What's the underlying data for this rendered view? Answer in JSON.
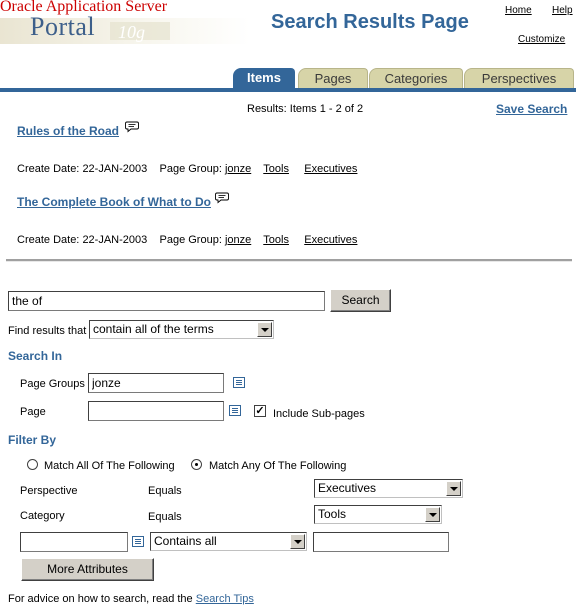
{
  "header": {
    "brand_top": "Oracle Application Server",
    "brand_product": "Portal",
    "brand_version": "10g",
    "page_title": "Search Results Page",
    "links": {
      "home": "Home",
      "help": "Help",
      "customize": "Customize"
    }
  },
  "tabs": [
    {
      "label": "Items",
      "active": true
    },
    {
      "label": "Pages",
      "active": false
    },
    {
      "label": "Categories",
      "active": false
    },
    {
      "label": "Perspectives",
      "active": false
    }
  ],
  "results": {
    "summary": "Results: Items 1 - 2 of 2",
    "save_search": "Save Search",
    "items": [
      {
        "title": "Rules of the Road",
        "create_label": "Create Date:",
        "create_date": "22-JAN-2003",
        "page_group_label": "Page Group:",
        "page_group": "jonze",
        "category": "Tools",
        "perspective": "Executives"
      },
      {
        "title": "The Complete Book of What to Do",
        "create_label": "Create Date:",
        "create_date": "22-JAN-2003",
        "page_group_label": "Page Group:",
        "page_group": "jonze",
        "category": "Tools",
        "perspective": "Executives"
      }
    ]
  },
  "search_form": {
    "query": "the of",
    "search_button": "Search",
    "find_results_label": "Find results that",
    "find_results_value": "contain all of the terms",
    "search_in_heading": "Search In",
    "page_groups_label": "Page Groups",
    "page_groups_value": "jonze",
    "page_label": "Page",
    "page_value": "",
    "include_subpages_label": "Include Sub-pages",
    "include_subpages_checked": true,
    "filter_by_heading": "Filter By",
    "match_all_label": "Match All Of The Following",
    "match_any_label": "Match Any Of The Following",
    "match_selected": "any",
    "filters": [
      {
        "attribute": "Perspective",
        "operator": "Equals",
        "value": "Executives"
      },
      {
        "attribute": "Category",
        "operator": "Equals",
        "value": "Tools"
      }
    ],
    "custom_filter": {
      "attribute": "",
      "operator": "Contains all",
      "value": ""
    },
    "more_attributes_button": "More Attributes",
    "advice_text": "For advice on how to search, read the",
    "advice_link": "Search Tips"
  }
}
